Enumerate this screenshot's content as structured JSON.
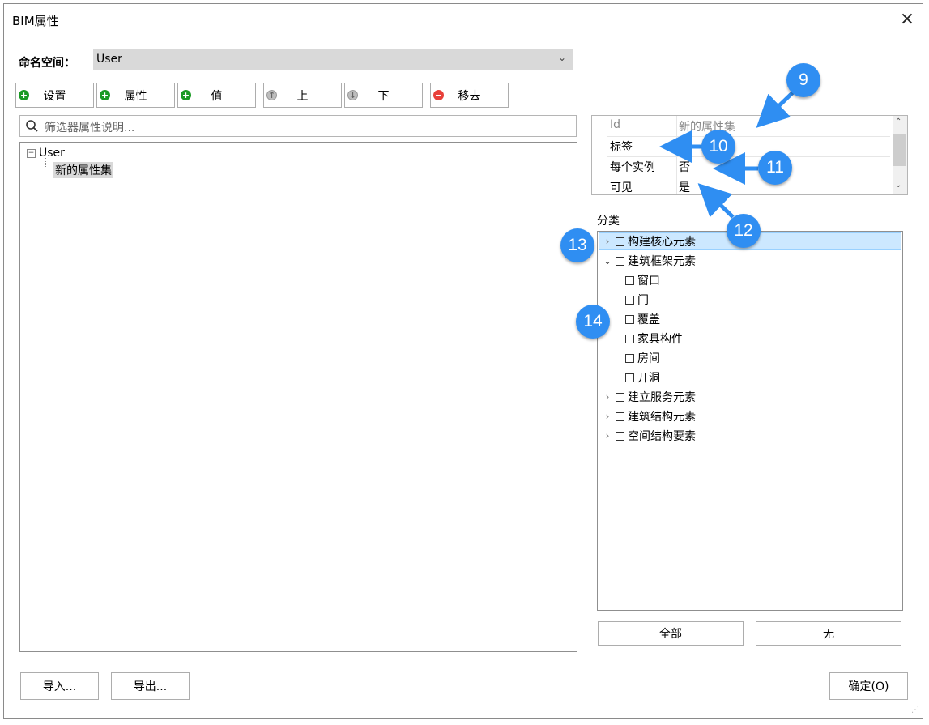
{
  "window": {
    "title": "BIM属性",
    "close_icon": "close-icon"
  },
  "namespace": {
    "label": "命名空间：",
    "value": "User"
  },
  "toolbar": {
    "buttons": [
      {
        "label": "设置",
        "icon": "add-icon"
      },
      {
        "label": "属性",
        "icon": "add-icon"
      },
      {
        "label": "值",
        "icon": "add-icon"
      },
      {
        "label": "上",
        "icon": "up-icon"
      },
      {
        "label": "下",
        "icon": "down-icon"
      },
      {
        "label": "移去",
        "icon": "remove-icon"
      }
    ]
  },
  "filter": {
    "placeholder": "筛选器属性说明..."
  },
  "left_tree": {
    "root": "User",
    "child": "新的属性集"
  },
  "property_grid": {
    "rows": [
      {
        "key": "Id",
        "value": "新的属性集"
      },
      {
        "key": "标签",
        "value": ""
      },
      {
        "key": "每个实例",
        "value": "否"
      },
      {
        "key": "可见",
        "value": "是"
      }
    ]
  },
  "classification": {
    "label": "分类",
    "items": [
      {
        "label": "构建核心元素"
      },
      {
        "label": "建筑框架元素"
      },
      {
        "label": "窗口"
      },
      {
        "label": "门"
      },
      {
        "label": "覆盖"
      },
      {
        "label": "家具构件"
      },
      {
        "label": "房间"
      },
      {
        "label": "开洞"
      },
      {
        "label": "建立服务元素"
      },
      {
        "label": "建筑结构元素"
      },
      {
        "label": "空间结构要素"
      }
    ],
    "all_button": "全部",
    "none_button": "无"
  },
  "callouts": [
    "9",
    "10",
    "11",
    "12",
    "13",
    "14"
  ],
  "footer": {
    "import": "导入...",
    "export": "导出...",
    "ok": "确定(O)"
  },
  "colors": {
    "callout_blue": "#2f8ef2",
    "selection_blue": "#cce8ff",
    "add_green": "#1a9a24",
    "remove_red": "#e8403a"
  }
}
